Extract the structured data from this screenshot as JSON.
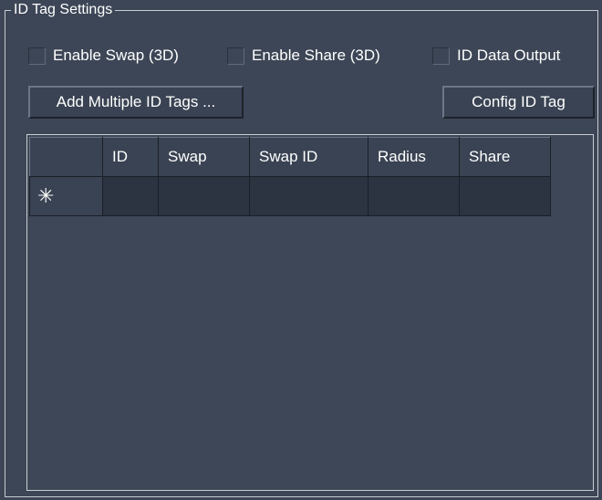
{
  "group": {
    "title": "ID Tag Settings"
  },
  "options": {
    "enable_swap": "Enable Swap (3D)",
    "enable_share": "Enable Share (3D)",
    "id_data_output": "ID Data Output"
  },
  "buttons": {
    "add_multiple": "Add Multiple ID Tags ...",
    "config": "Config ID Tag"
  },
  "grid": {
    "columns": [
      "ID",
      "Swap",
      "Swap ID",
      "Radius",
      "Share"
    ],
    "new_row_marker": "✳"
  }
}
